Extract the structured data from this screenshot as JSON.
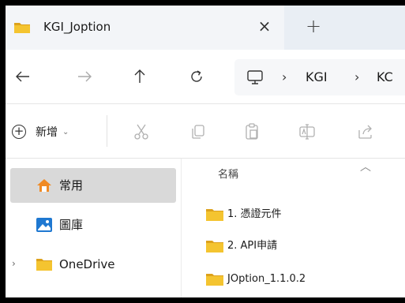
{
  "tab": {
    "title": "KGI_Joption",
    "close_glyph": "×",
    "new_tab_glyph": "+"
  },
  "nav": {
    "back_glyph": "←",
    "forward_glyph": "→",
    "up_glyph": "↑",
    "refresh_glyph": "C",
    "breadcrumb": [
      "KGI",
      "KC"
    ],
    "chevron": "›"
  },
  "toolbar": {
    "new_label": "新增",
    "new_caret": "⌄",
    "icons": [
      "cut-icon",
      "copy-icon",
      "paste-icon",
      "rename-icon",
      "share-icon"
    ]
  },
  "sidebar": {
    "items": [
      {
        "label": "常用",
        "icon": "star-home-icon",
        "selected": true
      },
      {
        "label": "圖庫",
        "icon": "gallery-icon",
        "selected": false
      },
      {
        "label": "OneDrive",
        "icon": "folder-icon",
        "selected": false,
        "expander": "›"
      }
    ]
  },
  "content": {
    "column_header": "名稱",
    "sort_caret": "︿",
    "files": [
      {
        "name": "1. 憑證元件",
        "icon": "folder-icon"
      },
      {
        "name": "2. API申請",
        "icon": "folder-icon"
      },
      {
        "name": "JOption_1.1.0.2",
        "icon": "folder-icon"
      }
    ]
  },
  "colors": {
    "folder_yellow": "#f4c430",
    "folder_dark": "#dda21c",
    "home_orange": "#f08a24",
    "gallery_blue": "#1f78d1",
    "selected_bg": "#d9d9d9"
  }
}
